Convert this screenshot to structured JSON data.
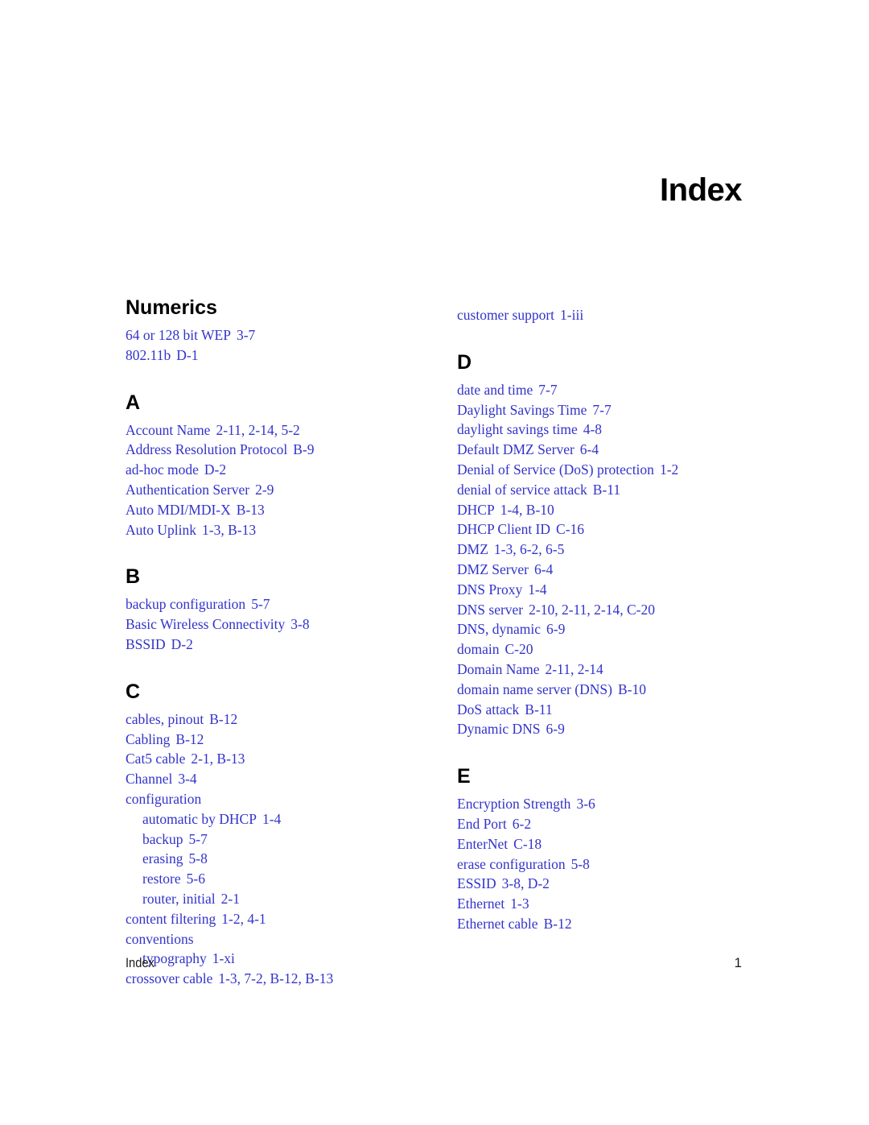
{
  "document": {
    "title": "Index",
    "footer_left": "Index",
    "footer_page_number": "1",
    "entry_color": "#3333CC",
    "heading_color": "#000000"
  },
  "columns": [
    {
      "name": "left-column",
      "sections": [
        {
          "heading": "Numerics",
          "heading_style": "word",
          "entries": [
            {
              "term": "64 or 128 bit WEP",
              "locations": "3-7",
              "level": 0
            },
            {
              "term": "802.11b",
              "locations": "D-1",
              "level": 0
            }
          ]
        },
        {
          "heading": "A",
          "heading_style": "letter",
          "entries": [
            {
              "term": "Account Name",
              "locations": "2-11, 2-14, 5-2",
              "level": 0
            },
            {
              "term": "Address Resolution Protocol",
              "locations": "B-9",
              "level": 0
            },
            {
              "term": "ad-hoc mode",
              "locations": "D-2",
              "level": 0
            },
            {
              "term": "Authentication Server",
              "locations": "2-9",
              "level": 0
            },
            {
              "term": "Auto MDI/MDI-X",
              "locations": "B-13",
              "level": 0
            },
            {
              "term": "Auto Uplink",
              "locations": "1-3, B-13",
              "level": 0
            }
          ]
        },
        {
          "heading": "B",
          "heading_style": "letter",
          "entries": [
            {
              "term": "backup configuration",
              "locations": "5-7",
              "level": 0
            },
            {
              "term": "Basic Wireless Connectivity",
              "locations": "3-8",
              "level": 0
            },
            {
              "term": "BSSID",
              "locations": "D-2",
              "level": 0
            }
          ]
        },
        {
          "heading": "C",
          "heading_style": "letter",
          "entries": [
            {
              "term": "cables, pinout",
              "locations": "B-12",
              "level": 0
            },
            {
              "term": "Cabling",
              "locations": "B-12",
              "level": 0
            },
            {
              "term": "Cat5 cable",
              "locations": "2-1, B-13",
              "level": 0
            },
            {
              "term": "Channel",
              "locations": "3-4",
              "level": 0
            },
            {
              "term": "configuration",
              "locations": "",
              "level": 0
            },
            {
              "term": "automatic by DHCP",
              "locations": "1-4",
              "level": 1
            },
            {
              "term": "backup",
              "locations": "5-7",
              "level": 1
            },
            {
              "term": "erasing",
              "locations": "5-8",
              "level": 1
            },
            {
              "term": "restore",
              "locations": "5-6",
              "level": 1
            },
            {
              "term": "router, initial",
              "locations": "2-1",
              "level": 1
            },
            {
              "term": "content filtering",
              "locations": "1-2, 4-1",
              "level": 0
            },
            {
              "term": "conventions",
              "locations": "",
              "level": 0
            },
            {
              "term": "typography",
              "locations": "1-xi",
              "level": 1
            },
            {
              "term": "crossover cable",
              "locations": "1-3, 7-2, B-12, B-13",
              "level": 0
            }
          ]
        }
      ]
    },
    {
      "name": "right-column",
      "sections": [
        {
          "heading": "",
          "heading_style": "none",
          "entries": [
            {
              "term": "customer support",
              "locations": "1-iii",
              "level": 0
            }
          ]
        },
        {
          "heading": "D",
          "heading_style": "letter",
          "entries": [
            {
              "term": "date and time",
              "locations": "7-7",
              "level": 0
            },
            {
              "term": "Daylight Savings Time",
              "locations": "7-7",
              "level": 0
            },
            {
              "term": "daylight savings time",
              "locations": "4-8",
              "level": 0
            },
            {
              "term": "Default DMZ Server",
              "locations": "6-4",
              "level": 0
            },
            {
              "term": "Denial of Service (DoS) protection",
              "locations": "1-2",
              "level": 0
            },
            {
              "term": "denial of service attack",
              "locations": "B-11",
              "level": 0
            },
            {
              "term": "DHCP",
              "locations": "1-4, B-10",
              "level": 0
            },
            {
              "term": "DHCP Client ID",
              "locations": "C-16",
              "level": 0
            },
            {
              "term": "DMZ",
              "locations": "1-3, 6-2, 6-5",
              "level": 0
            },
            {
              "term": "DMZ Server",
              "locations": "6-4",
              "level": 0
            },
            {
              "term": "DNS Proxy",
              "locations": "1-4",
              "level": 0
            },
            {
              "term": "DNS server",
              "locations": "2-10, 2-11, 2-14, C-20",
              "level": 0
            },
            {
              "term": "DNS, dynamic",
              "locations": "6-9",
              "level": 0
            },
            {
              "term": "domain",
              "locations": "C-20",
              "level": 0
            },
            {
              "term": "Domain Name",
              "locations": "2-11, 2-14",
              "level": 0
            },
            {
              "term": "domain name server (DNS)",
              "locations": "B-10",
              "level": 0
            },
            {
              "term": "DoS attack",
              "locations": "B-11",
              "level": 0
            },
            {
              "term": "Dynamic DNS",
              "locations": "6-9",
              "level": 0
            }
          ]
        },
        {
          "heading": "E",
          "heading_style": "letter",
          "entries": [
            {
              "term": "Encryption Strength",
              "locations": "3-6",
              "level": 0
            },
            {
              "term": "End Port",
              "locations": "6-2",
              "level": 0
            },
            {
              "term": "EnterNet",
              "locations": "C-18",
              "level": 0
            },
            {
              "term": "erase configuration",
              "locations": "5-8",
              "level": 0
            },
            {
              "term": "ESSID",
              "locations": "3-8, D-2",
              "level": 0
            },
            {
              "term": "Ethernet",
              "locations": "1-3",
              "level": 0
            },
            {
              "term": "Ethernet cable",
              "locations": "B-12",
              "level": 0
            }
          ]
        }
      ]
    }
  ]
}
